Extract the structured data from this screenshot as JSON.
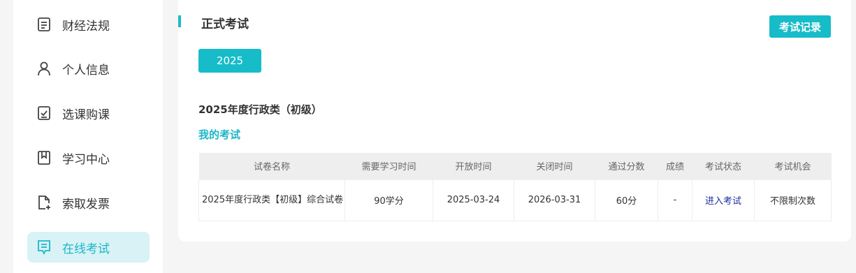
{
  "sidebar": {
    "items": [
      {
        "label": "财经法规",
        "icon": "document-icon"
      },
      {
        "label": "个人信息",
        "icon": "user-icon"
      },
      {
        "label": "选课购课",
        "icon": "checkbox-icon"
      },
      {
        "label": "学习中心",
        "icon": "bookmark-icon"
      },
      {
        "label": "索取发票",
        "icon": "file-add-icon"
      },
      {
        "label": "在线考试",
        "icon": "exam-icon"
      }
    ],
    "active_index": 5
  },
  "main": {
    "title": "正式考试",
    "record_button": "考试记录",
    "year_button": "2025",
    "exam_name": "2025年度行政类（初级）",
    "my_exam_label": "我的考试",
    "table": {
      "headers": [
        "试卷名称",
        "需要学习时间",
        "开放时间",
        "关闭时间",
        "通过分数",
        "成绩",
        "考试状态",
        "考试机会"
      ],
      "rows": [
        [
          "2025年度行政类【初级】综合试卷",
          "90学分",
          "2025-03-24",
          "2026-03-31",
          "60分",
          "-",
          "进入考试",
          "不限制次数"
        ]
      ]
    }
  },
  "colors": {
    "accent": "#17bcc9",
    "active_bg": "#d8f2f6",
    "link": "#1a2ea0"
  }
}
